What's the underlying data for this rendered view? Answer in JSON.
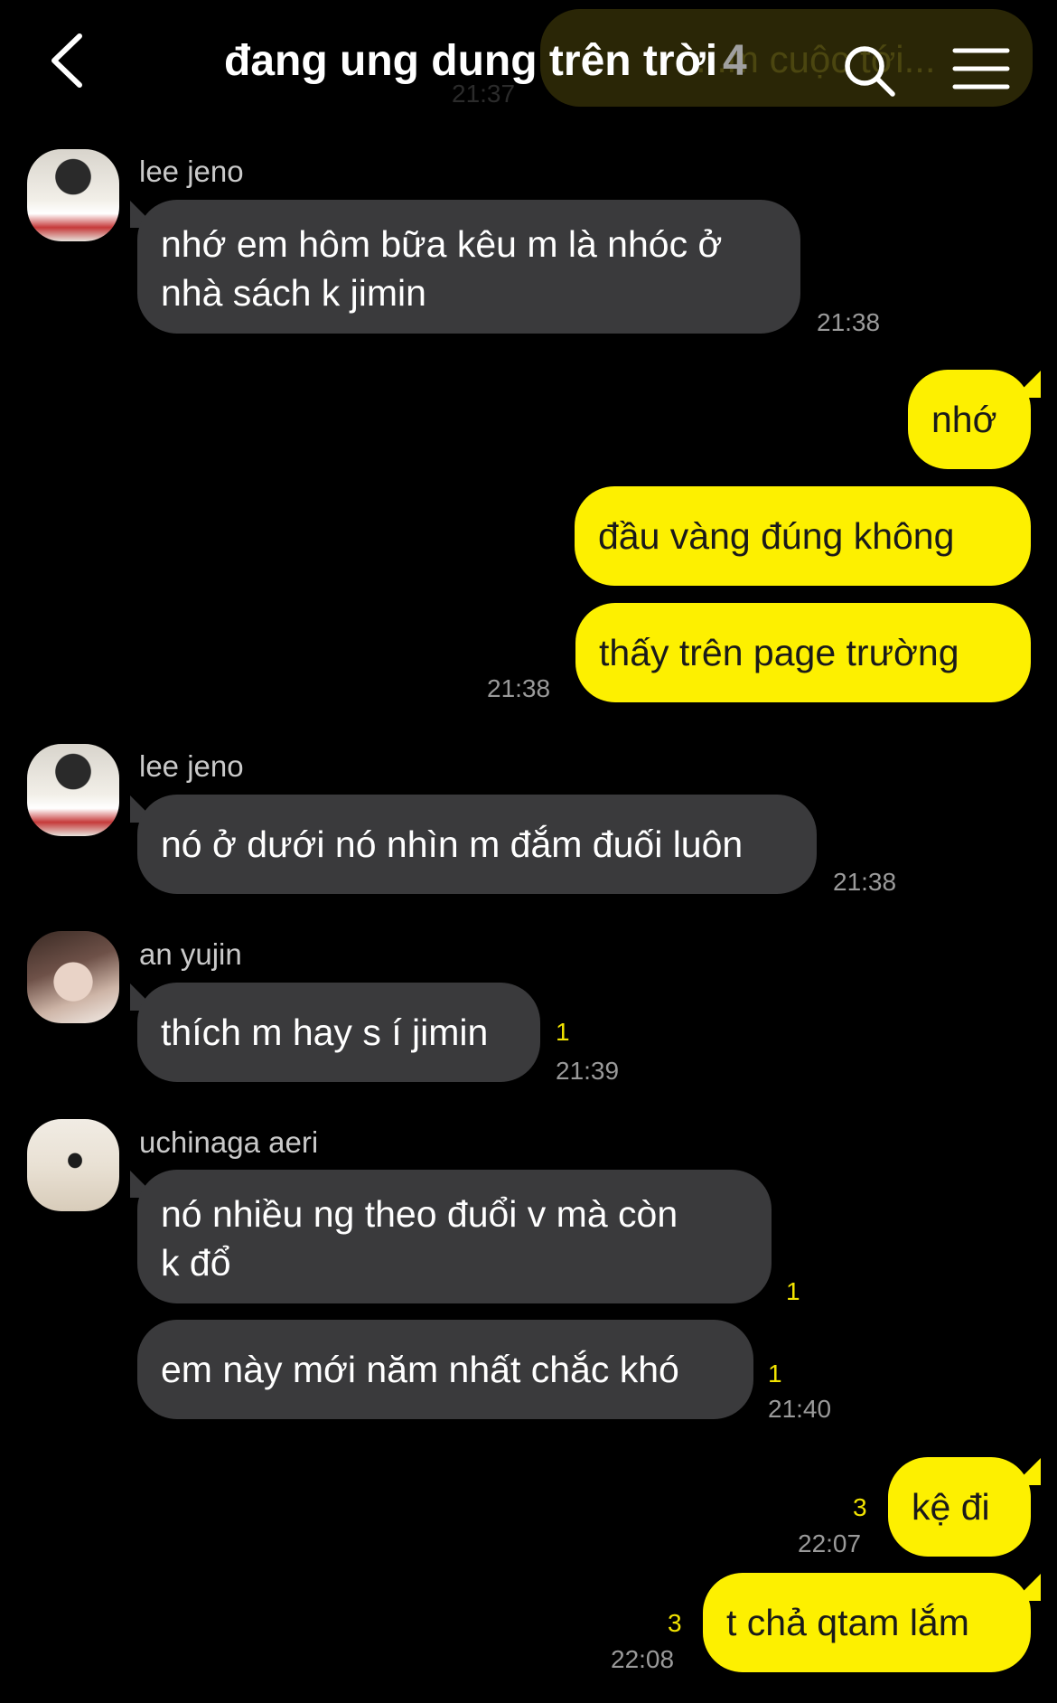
{
  "header": {
    "title": "đang ung dung trên trời",
    "member_count": "4",
    "ghost_preview": "...m cuộc tới...",
    "ghost_time": "21:37"
  },
  "messages": [
    {
      "sender": "lee jeno",
      "text": [
        "nhớ em hôm bữa kêu m là nhóc ở",
        "nhà sách k jimin"
      ],
      "time": "21:38"
    },
    {
      "out": [
        "nhớ",
        "đầu vàng đúng không",
        "thấy trên page trường"
      ],
      "time": "21:38"
    },
    {
      "sender": "lee jeno",
      "text": [
        "nó ở dưới nó nhìn m đắm đuối luôn"
      ],
      "time": "21:38"
    },
    {
      "sender": "an yujin",
      "text": [
        "thích m hay s í jimin"
      ],
      "unread": "1",
      "time": "21:39"
    },
    {
      "sender": "uchinaga aeri",
      "text": [
        "nó nhiều ng theo đuổi v mà còn",
        "k đổ"
      ],
      "unread": "1"
    },
    {
      "text": [
        "em này mới năm nhất chắc khó"
      ],
      "unread": "1",
      "time": "21:40"
    },
    {
      "out": [
        "kệ đi"
      ],
      "unread": "3",
      "time": "22:07"
    },
    {
      "out": [
        "t chả qtam lắm"
      ],
      "unread": "3",
      "time": "22:08"
    }
  ]
}
